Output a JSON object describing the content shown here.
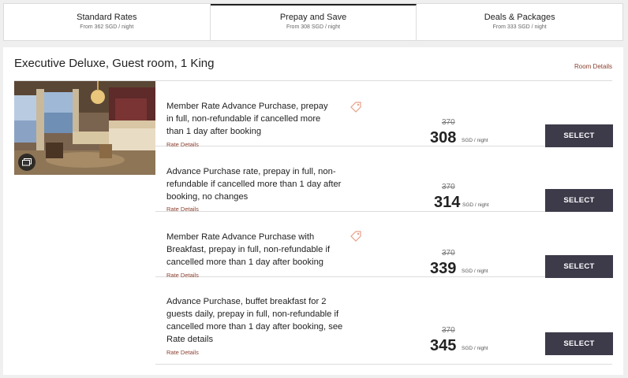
{
  "tabs": [
    {
      "title": "Standard Rates",
      "sub": "From 362 SGD / night"
    },
    {
      "title": "Prepay and Save",
      "sub": "From 308 SGD / night"
    },
    {
      "title": "Deals & Packages",
      "sub": "From 333 SGD / night"
    }
  ],
  "room": {
    "title": "Executive Deluxe, Guest room, 1 King",
    "details_link": "Room Details"
  },
  "rates": [
    {
      "lines": [
        "Member Rate Advance Purchase, prepay",
        "in full, non-refundable if cancelled more",
        "than 1 day after booking"
      ],
      "link": "Rate Details",
      "old_price": "370",
      "price": "308",
      "unit": "SGD / night",
      "button": "SELECT"
    },
    {
      "lines": [
        "Advance Purchase rate, prepay in full, non-",
        "refundable if cancelled more than 1 day after",
        "booking, no changes"
      ],
      "link": "Rate Details",
      "old_price": "370",
      "price": "314",
      "unit": "SGD / night",
      "button": "SELECT"
    },
    {
      "lines": [
        "Member Rate Advance Purchase with",
        "Breakfast, prepay in full, non-refundable if",
        "cancelled more than 1 day after booking"
      ],
      "link": "Rate Details",
      "old_price": "370",
      "price": "339",
      "unit": "SGD / night",
      "button": "SELECT"
    },
    {
      "lines": [
        "Advance Purchase, buffet breakfast for 2",
        "guests daily, prepay in full, non-refundable if",
        "cancelled more than 1 day after booking, see",
        "Rate details"
      ],
      "link": "Rate Details",
      "old_price": "370",
      "price": "345",
      "unit": "SGD / night",
      "button": "SELECT"
    }
  ],
  "colors": {
    "link": "#8b3f2e",
    "button_bg": "#3d3a49",
    "tag_icon": "#e8a08a"
  }
}
